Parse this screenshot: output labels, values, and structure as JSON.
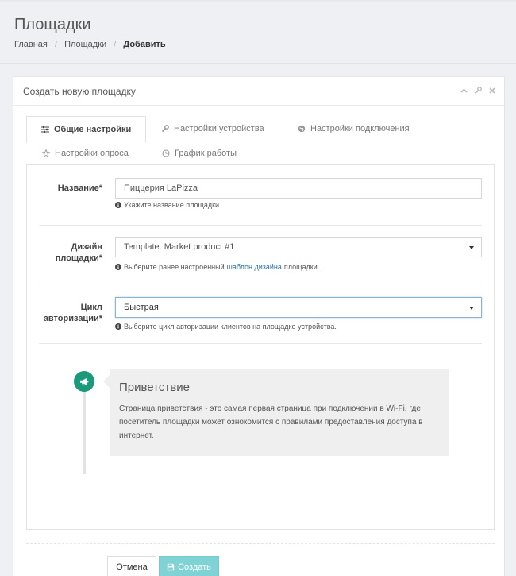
{
  "page": {
    "title": "Площадки",
    "breadcrumb": [
      {
        "label": "Главная"
      },
      {
        "label": "Площадки"
      },
      {
        "label": "Добавить"
      }
    ]
  },
  "panel": {
    "title": "Создать новую площадку",
    "tools": [
      "chevron-up-icon",
      "wrench-icon",
      "close-icon"
    ]
  },
  "tabs": [
    {
      "label": "Общие настройки",
      "icon": "sliders-icon",
      "active": true
    },
    {
      "label": "Настройки устройства",
      "icon": "wrench-icon",
      "active": false
    },
    {
      "label": "Настройки подключения",
      "icon": "globe-icon",
      "active": false
    },
    {
      "label": "Настройки опроса",
      "icon": "star-icon",
      "active": false
    },
    {
      "label": "График работы",
      "icon": "clock-icon",
      "active": false
    }
  ],
  "form": {
    "name": {
      "label": "Название*",
      "value": "Пиццерия LaPizza",
      "help": "Укажите название площадки."
    },
    "design": {
      "label_line1": "Дизайн",
      "label_line2": "площадки*",
      "value": "Template. Market product #1",
      "help_before": "Выберите ранее настроенный",
      "help_link": "шаблон дизайна",
      "help_after": "площадки."
    },
    "auth_cycle": {
      "label_line1": "Цикл",
      "label_line2": "авторизации*",
      "value": "Быстрая",
      "help": "Выберите цикл авторизации клиентов на площадке устройства."
    }
  },
  "timeline": {
    "icon": "bullhorn-icon",
    "title": "Приветствие",
    "text": "Страница приветствия - это самая первая страница при подключении в Wi-Fi, где посетитель площадки может ознокомится с правилами предоставления доступа в интернет."
  },
  "buttons": {
    "cancel": "Отмена",
    "create": "Создать"
  },
  "colors": {
    "accent_teal": "#1a9a7b",
    "create_button": "#7fd3d4",
    "link": "#2e6fa6"
  }
}
